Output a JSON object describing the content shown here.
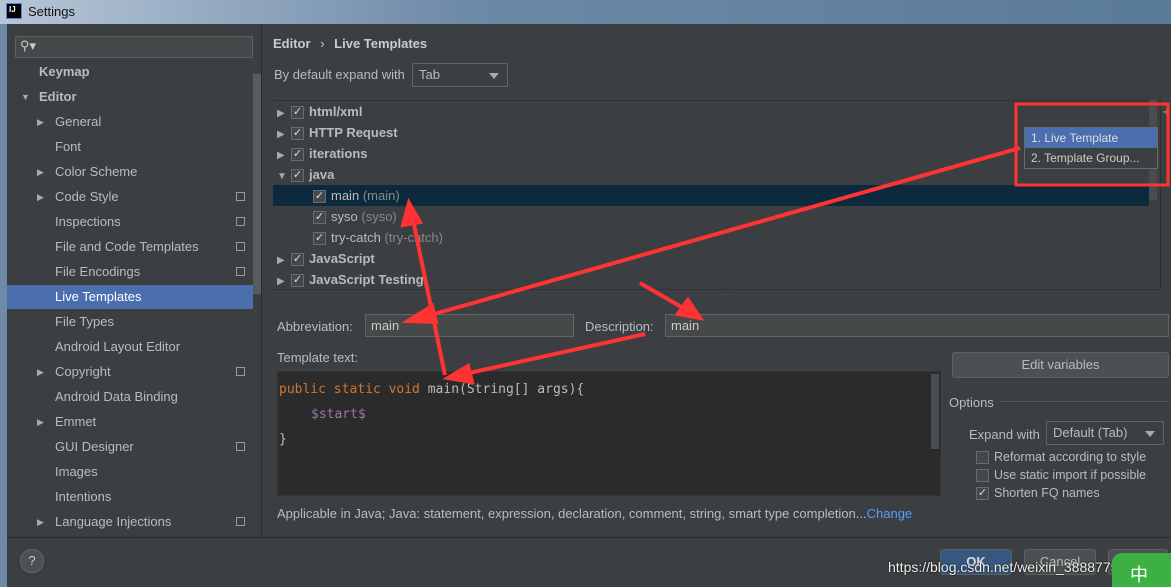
{
  "window": {
    "title": "Settings"
  },
  "sidebar": {
    "search_placeholder": "",
    "items": [
      {
        "label": "Keymap",
        "level": 0
      },
      {
        "label": "Editor",
        "level": 0,
        "expanded": true
      },
      {
        "label": "General",
        "level": 1,
        "arrow": true
      },
      {
        "label": "Font",
        "level": 1
      },
      {
        "label": "Color Scheme",
        "level": 1,
        "arrow": true
      },
      {
        "label": "Code Style",
        "level": 1,
        "arrow": true,
        "copy": true
      },
      {
        "label": "Inspections",
        "level": 1,
        "copy": true
      },
      {
        "label": "File and Code Templates",
        "level": 1,
        "copy": true
      },
      {
        "label": "File Encodings",
        "level": 1,
        "copy": true
      },
      {
        "label": "Live Templates",
        "level": 1,
        "selected": true
      },
      {
        "label": "File Types",
        "level": 1
      },
      {
        "label": "Android Layout Editor",
        "level": 1
      },
      {
        "label": "Copyright",
        "level": 1,
        "arrow": true,
        "copy": true
      },
      {
        "label": "Android Data Binding",
        "level": 1
      },
      {
        "label": "Emmet",
        "level": 1,
        "arrow": true
      },
      {
        "label": "GUI Designer",
        "level": 1,
        "copy": true
      },
      {
        "label": "Images",
        "level": 1
      },
      {
        "label": "Intentions",
        "level": 1
      },
      {
        "label": "Language Injections",
        "level": 1,
        "arrow": true,
        "copy": true
      }
    ]
  },
  "breadcrumb": {
    "parent": "Editor",
    "sep": "›",
    "current": "Live Templates"
  },
  "expand": {
    "label": "By default expand with",
    "value": "Tab"
  },
  "tree": [
    {
      "name": "html/xml",
      "group": true
    },
    {
      "name": "HTTP Request",
      "group": true
    },
    {
      "name": "iterations",
      "group": true
    },
    {
      "name": "java",
      "group": true,
      "expanded": true
    },
    {
      "name": "main",
      "desc": "(main)",
      "selected": true
    },
    {
      "name": "syso",
      "desc": "(syso)"
    },
    {
      "name": "try-catch",
      "desc": "(try-catch)"
    },
    {
      "name": "JavaScript",
      "group": true
    },
    {
      "name": "JavaScript Testing",
      "group": true
    }
  ],
  "popup": {
    "items": [
      "1. Live Template",
      "2. Template Group..."
    ]
  },
  "form": {
    "abbr_label": "Abbreviation:",
    "abbr_value": "main",
    "desc_label": "Description:",
    "desc_value": "main",
    "template_label": "Template text:"
  },
  "code": {
    "line1_kw": "public static void ",
    "line1_rest": "main(String[] args){",
    "line2": "$start$",
    "line3": "}"
  },
  "edit_vars": "Edit variables",
  "options": {
    "title": "Options",
    "expand_label": "Expand with",
    "expand_value": "Default (Tab)",
    "checks": [
      {
        "label": "Reformat according to style",
        "checked": false
      },
      {
        "label": "Use static import if possible",
        "checked": false
      },
      {
        "label": "Shorten FQ names",
        "checked": true
      }
    ]
  },
  "applicable": {
    "text": "Applicable in Java; Java: statement, expression, declaration, comment, string, smart type completion...",
    "link": "Change"
  },
  "buttons": {
    "help": "?",
    "ok": "OK",
    "cancel": "Cancel"
  },
  "watermark": "https://blog.csdn.net/weixin_38887752",
  "ime": "中",
  "colors": {
    "selection": "#4b6eaf",
    "tree_selection": "#0d293e",
    "keyword": "#cc7832",
    "variable": "#9876aa",
    "link": "#589df6",
    "annotation": "#ff3333"
  }
}
